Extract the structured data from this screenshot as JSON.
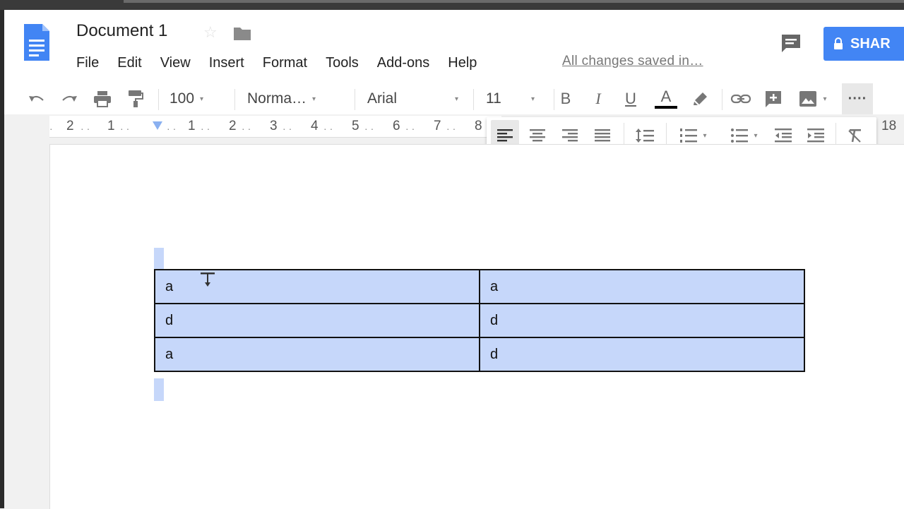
{
  "document": {
    "title": "Document 1",
    "saved_status": "All changes saved in…"
  },
  "menu": [
    "File",
    "Edit",
    "View",
    "Insert",
    "Format",
    "Tools",
    "Add-ons",
    "Help"
  ],
  "share": {
    "label": "SHAR"
  },
  "toolbar": {
    "zoom": "100",
    "style": "Norma…",
    "font": "Arial",
    "font_size": "11",
    "bold": "B",
    "italic": "I",
    "underline": "U",
    "text_color": "A",
    "more": "····"
  },
  "ruler": {
    "labels": [
      "2",
      "1",
      "1",
      "2",
      "3",
      "4",
      "5",
      "6",
      "7",
      "8"
    ],
    "end_label": "18"
  },
  "table": {
    "rows": [
      [
        "a",
        "a"
      ],
      [
        "d",
        "d"
      ],
      [
        "a",
        "d"
      ]
    ]
  },
  "colors": {
    "accent": "#4285f4",
    "selection": "#c6d7fa"
  }
}
